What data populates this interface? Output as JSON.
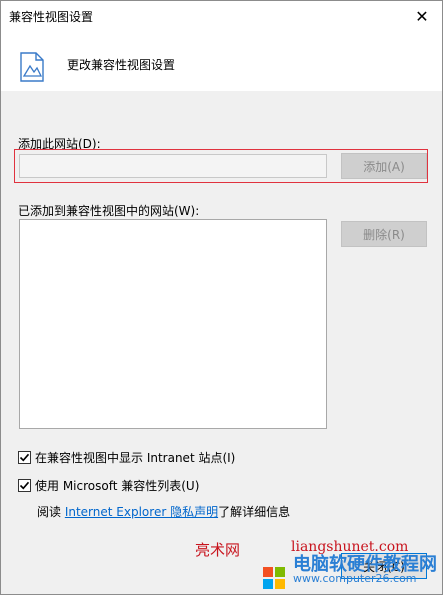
{
  "window": {
    "title": "兼容性视图设置",
    "close_glyph": "✕"
  },
  "header": {
    "title": "更改兼容性视图设置",
    "icon": "settings-page-icon"
  },
  "add_site": {
    "label": "添加此网站(D):",
    "input_value": "",
    "add_button": "添加(A)"
  },
  "site_list": {
    "label": "已添加到兼容性视图中的网站(W):",
    "items": [],
    "remove_button": "删除(R)"
  },
  "options": {
    "intranet": {
      "label": "在兼容性视图中显示 Intranet 站点(I)",
      "checked": true
    },
    "ms_list": {
      "label": "使用 Microsoft 兼容性列表(U)",
      "checked": true
    }
  },
  "info": {
    "prefix": "阅读 ",
    "link": "Internet Explorer 隐私声明",
    "suffix": "了解详细信息"
  },
  "footer": {
    "close_button": "关闭(C)"
  },
  "watermark": {
    "text1": "亮术网",
    "url1": "liangshunet.com",
    "text2": "电脑软硬件教程网",
    "url2": "www.computer26.com"
  },
  "colors": {
    "highlight": "#e0323e",
    "link": "#0066cc",
    "primary_border": "#0078d7",
    "watermark_red": "#c8141e",
    "watermark_blue": "#2a7fd4"
  }
}
